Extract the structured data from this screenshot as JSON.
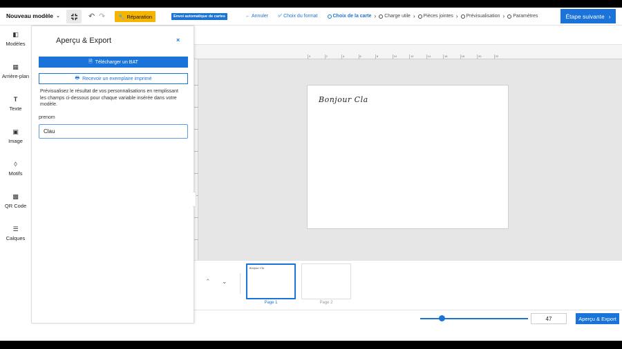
{
  "topbar": {
    "model_name": "Nouveau modèle",
    "repair_label": "Réparation",
    "auto_badge": "Envoi automatique de cartes",
    "next_label": "Étape suivante",
    "steps": [
      {
        "label": "Annuler"
      },
      {
        "label": "Choix du format"
      },
      {
        "label": "Choix de la carte"
      },
      {
        "label": "Charge utile"
      },
      {
        "label": "Pièces jointes"
      },
      {
        "label": "Prévisualisation"
      },
      {
        "label": "Paramètres"
      }
    ]
  },
  "rail": {
    "items": [
      {
        "label": "Modèles",
        "icon": "templates-icon"
      },
      {
        "label": "Arrière-plan",
        "icon": "background-icon"
      },
      {
        "label": "Texte",
        "icon": "text-icon"
      },
      {
        "label": "Image",
        "icon": "image-icon"
      },
      {
        "label": "Motifs",
        "icon": "shapes-icon"
      },
      {
        "label": "QR Code",
        "icon": "qr-code-icon"
      },
      {
        "label": "Calques",
        "icon": "layers-icon"
      }
    ]
  },
  "panel": {
    "title": "Aperçu & Export",
    "close": "×",
    "bat_label": "Télécharger un BAT",
    "print_label": "Recevoir un exemplaire imprimé",
    "description": "Prévisualisez le résultat de vos personnalisations en remplissant les champs ci-dessous pour chaque variable insérée dans votre modèle.",
    "field_label": "prenom",
    "field_value": "Clau"
  },
  "ruler": {
    "ticks": [
      "0",
      "2",
      "4",
      "6",
      "8",
      "10",
      "12",
      "14",
      "16",
      "18",
      "20",
      "22"
    ]
  },
  "card": {
    "text": "Bonjour Cla"
  },
  "thumbnails": {
    "pages": [
      {
        "label": "Page 1",
        "preview": "Bonjour Cla",
        "selected": true
      },
      {
        "label": "Page 2",
        "preview": "",
        "selected": false
      }
    ]
  },
  "bottom": {
    "zoom_value": "47",
    "zoom_fraction": 0.2,
    "export_label": "Aperçu & Export"
  },
  "colors": {
    "accent": "#1a73d9",
    "repair": "#f5b400"
  }
}
